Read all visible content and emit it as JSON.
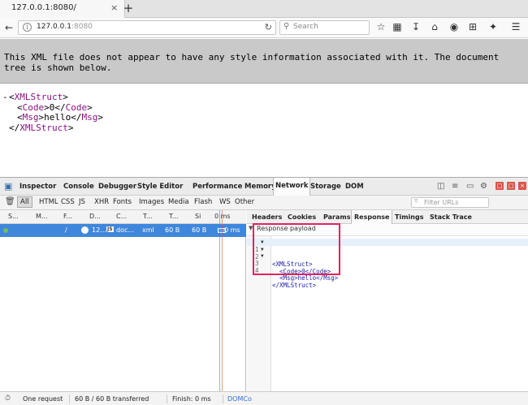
{
  "browser": {
    "tab_title": "127.0.0.1:8080/",
    "tab_close": "×",
    "new_tab": "+",
    "url_host": "127.0.0.1",
    "url_port": ":8080",
    "search_placeholder": "Search"
  },
  "page": {
    "banner_text": "This XML file does not appear to have any style information associated with it. The document tree is shown below.",
    "xml_lines": [
      {
        "collapser": "-",
        "indent": "",
        "parts": [
          "<",
          "XMLStruct",
          ">",
          "",
          "",
          "",
          ""
        ]
      },
      {
        "collapser": "",
        "indent": "  ",
        "parts": [
          "<",
          "Code",
          ">",
          "0",
          "</",
          "Code",
          ">"
        ]
      },
      {
        "collapser": "",
        "indent": "  ",
        "parts": [
          "<",
          "Msg",
          ">",
          "hello",
          "</",
          "Msg",
          ">"
        ]
      },
      {
        "collapser": "",
        "indent": " ",
        "parts": [
          "</",
          "XMLStruct",
          ">",
          "",
          "",
          "",
          ""
        ]
      }
    ]
  },
  "devtools": {
    "tabs": [
      "Inspector",
      "Console",
      "Debugger",
      "Style Editor",
      "Performance",
      "Memory",
      "Network",
      "Storage",
      "DOM"
    ],
    "active_tab": "Network",
    "filters": [
      "All",
      "HTML",
      "CSS",
      "JS",
      "XHR",
      "Fonts",
      "Images",
      "Media",
      "Flash",
      "WS",
      "Other"
    ],
    "active_filter": "All",
    "filter_placeholder": "Filter URLs",
    "columns": [
      "S...",
      "M...",
      "F...",
      "D...",
      "C...",
      "T...",
      "T...",
      "Si",
      "0 ms"
    ],
    "request_row": {
      "status": "",
      "method": "",
      "file": "/",
      "domain": "12...",
      "cause": "doc...",
      "type": "xml",
      "transferred": "60 B",
      "size": "60 B",
      "timeline": "0 ms"
    },
    "detail_tabs": [
      "Headers",
      "Cookies",
      "Params",
      "Response",
      "Timings",
      "Stack Trace"
    ],
    "active_detail_tab": "Response",
    "payload_label": "Response payload",
    "code_lines": [
      {
        "num": "1",
        "fold": "▼",
        "text": "<XMLStruct>",
        "highlight": true
      },
      {
        "num": "2",
        "fold": "▼",
        "text": "  <Code>0</Code>",
        "highlight": false
      },
      {
        "num": "3",
        "fold": "▼",
        "text": "  <Msg>hello</Msg>",
        "highlight": false
      },
      {
        "num": "4",
        "fold": "",
        "text": "</XMLStruct>",
        "highlight": false
      }
    ],
    "status": {
      "requests": "One request",
      "transferred": "60 B / 60 B transferred",
      "finish": "Finish: 0 ms",
      "dom": "DOMCo"
    }
  },
  "colors": {
    "selected_row": "#3f87dc",
    "highlight_box": "#e0245e",
    "xml_tag": "#881280"
  }
}
